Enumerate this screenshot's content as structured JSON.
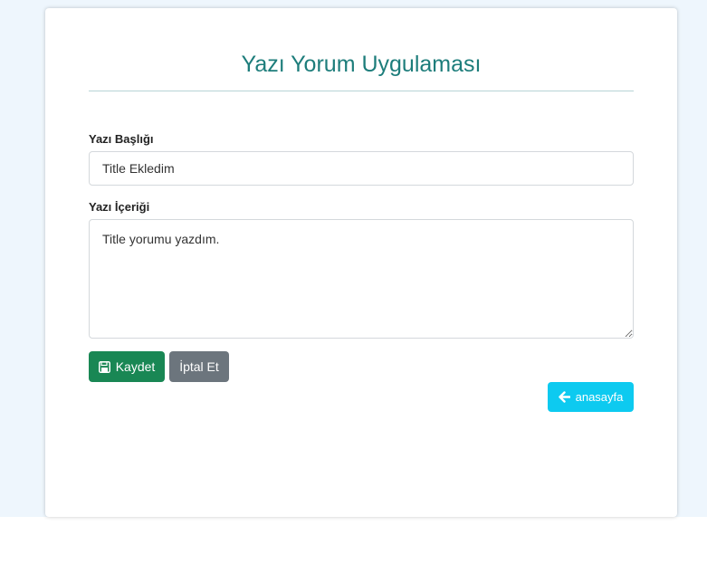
{
  "app": {
    "title": "Yazı Yorum Uygulaması"
  },
  "form": {
    "title_label": "Yazı Başlığı",
    "title_value": "Title Ekledim",
    "content_label": "Yazı İçeriği",
    "content_value": "Title yorumu yazdım."
  },
  "buttons": {
    "save_label": "Kaydet",
    "cancel_label": "İptal Et",
    "home_label": "anasayfa"
  },
  "colors": {
    "title": "#1d7d7b",
    "save": "#198754",
    "cancel": "#6c757d",
    "home": "#0dcaf0",
    "background": "#eef6fd"
  },
  "icons": {
    "save": "floppy-disk-icon",
    "home": "arrow-left-icon"
  }
}
